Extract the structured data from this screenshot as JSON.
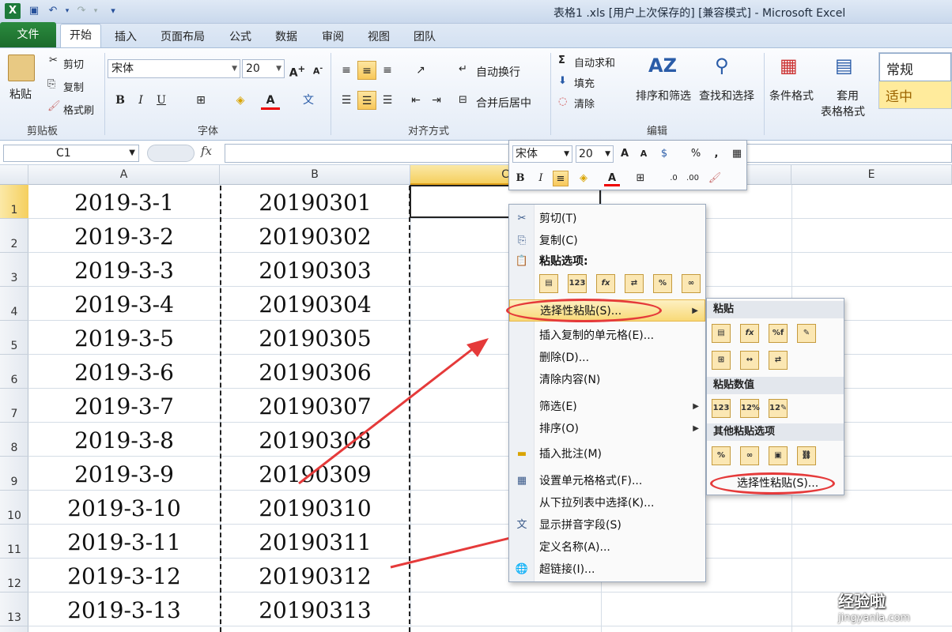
{
  "window": {
    "title": "表格1 .xls [用户上次保存的] [兼容模式] - Microsoft Excel",
    "logo": "X"
  },
  "tabs": {
    "file": "文件",
    "home": "开始",
    "items": [
      "插入",
      "页面布局",
      "公式",
      "数据",
      "审阅",
      "视图",
      "团队"
    ]
  },
  "ribbon": {
    "clipboard": {
      "paste": "粘贴",
      "cut": "剪切",
      "copy": "复制",
      "format_painter": "格式刷",
      "group": "剪贴板"
    },
    "font": {
      "name": "宋体",
      "size": "20",
      "group": "字体"
    },
    "alignment": {
      "wrap": "自动换行",
      "merge": "合并后居中",
      "group": "对齐方式"
    },
    "editing": {
      "autosum": "自动求和",
      "fill": "填充",
      "clear": "清除",
      "sort": "排序和筛选",
      "find": "查找和选择",
      "group": "编辑"
    },
    "styles": {
      "cond_format": "条件格式",
      "table_format_1": "套用",
      "table_format_2": "表格格式",
      "normal": "常规",
      "neutral": "适中"
    }
  },
  "formula_bar": {
    "name_box": "C1",
    "fx": "fx",
    "value": ""
  },
  "columns": [
    "A",
    "B",
    "C",
    "D",
    "E"
  ],
  "rows": [
    {
      "n": "1",
      "a": "2019-3-1",
      "b": "20190301"
    },
    {
      "n": "2",
      "a": "2019-3-2",
      "b": "20190302"
    },
    {
      "n": "3",
      "a": "2019-3-3",
      "b": "20190303"
    },
    {
      "n": "4",
      "a": "2019-3-4",
      "b": "20190304"
    },
    {
      "n": "5",
      "a": "2019-3-5",
      "b": "20190305"
    },
    {
      "n": "6",
      "a": "2019-3-6",
      "b": "20190306"
    },
    {
      "n": "7",
      "a": "2019-3-7",
      "b": "20190307"
    },
    {
      "n": "8",
      "a": "2019-3-8",
      "b": "20190308"
    },
    {
      "n": "9",
      "a": "2019-3-9",
      "b": "20190309"
    },
    {
      "n": "10",
      "a": "2019-3-10",
      "b": "20190310"
    },
    {
      "n": "11",
      "a": "2019-3-11",
      "b": "20190311"
    },
    {
      "n": "12",
      "a": "2019-3-12",
      "b": "20190312"
    },
    {
      "n": "13",
      "a": "2019-3-13",
      "b": "20190313"
    }
  ],
  "mini_toolbar": {
    "font": "宋体",
    "size": "20"
  },
  "context_menu": {
    "cut": "剪切(T)",
    "copy": "复制(C)",
    "paste_options": "粘贴选项:",
    "paste_special": "选择性粘贴(S)...",
    "insert_copied": "插入复制的单元格(E)...",
    "delete": "删除(D)...",
    "clear": "清除内容(N)",
    "filter": "筛选(E)",
    "sort": "排序(O)",
    "insert_comment": "插入批注(M)",
    "format_cells": "设置单元格格式(F)...",
    "pick_list": "从下拉列表中选择(K)...",
    "phonetic": "显示拼音字段(S)",
    "define_name": "定义名称(A)...",
    "hyperlink": "超链接(I)..."
  },
  "submenu": {
    "paste": "粘贴",
    "paste_values": "粘贴数值",
    "other": "其他粘贴选项",
    "paste_special": "选择性粘贴(S)..."
  },
  "watermark": {
    "line1": "经验啦",
    "line2": "jingyanla.com"
  },
  "accent": {
    "red": "#e53a3a",
    "excel_green": "#1d7a3a",
    "highlight": "#f8d977"
  }
}
